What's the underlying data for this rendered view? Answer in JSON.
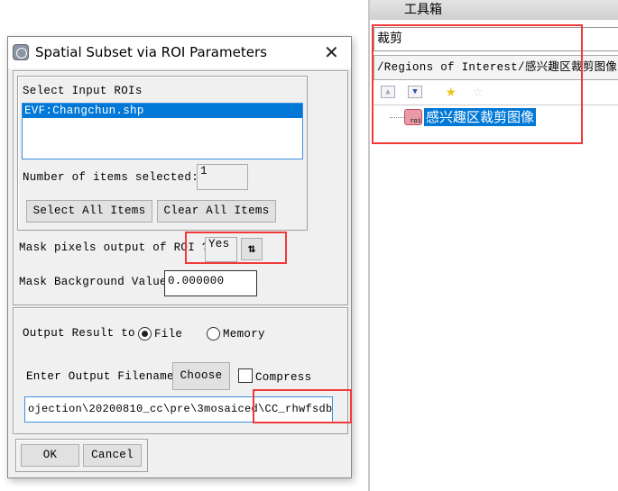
{
  "dialog": {
    "title": "Spatial Subset via ROI Parameters",
    "close_icon": "close-icon",
    "roi_section": {
      "label": "Select Input ROIs",
      "items": [
        "EVF:Changchun.shp"
      ],
      "selected_index": 0,
      "count_label": "Number of items selected:",
      "count_value": "1",
      "select_all": "Select All Items",
      "clear_all": "Clear All Items"
    },
    "mask": {
      "label": "Mask pixels output of ROI ?",
      "value": "Yes",
      "toggle_icon": "swap-arrows-icon",
      "bg_label": "Mask Background Value",
      "bg_value": "0.000000"
    },
    "output": {
      "label": "Output Result to",
      "options": [
        "File",
        "Memory"
      ],
      "selected": "File",
      "filename_label": "Enter Output Filename",
      "choose": "Choose",
      "compress": "Compress",
      "compress_checked": false,
      "filename": "ojection\\20200810_cc\\pre\\3mosaiced\\CC_rhwfsdb"
    },
    "ok": "OK",
    "cancel": "Cancel"
  },
  "toolbox": {
    "title": "工具箱",
    "search": "裁剪",
    "path": "/Regions of Interest/感兴趣区裁剪图像",
    "tree": [
      {
        "label": "感兴趣区裁剪图像",
        "icon": "roi-icon",
        "selected": true
      }
    ]
  },
  "annotation_color": "#f03a3a",
  "selection_color": "#0078d7"
}
